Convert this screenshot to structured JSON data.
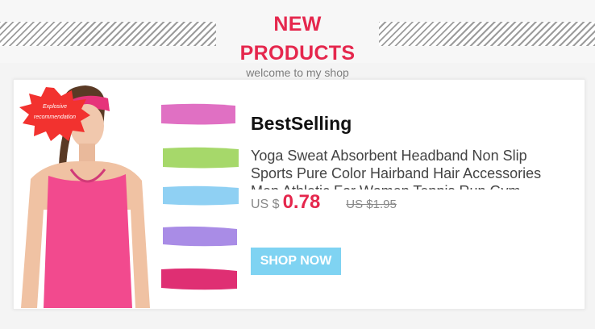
{
  "header": {
    "title": "NEW PRODUCTS",
    "subtitle": "welcome to my shop"
  },
  "product": {
    "badge": [
      "Explosive",
      "recommendation"
    ],
    "brand": "BestSelling",
    "title": "Yoga Sweat Absorbent Headband Non Slip Sports Pure Color Hairband Hair Accessories Men Athletic For Women Tennis Run Gym",
    "currency": "US $",
    "price": "0.78",
    "old_price": "US $1.95",
    "button_label": "SHOP NOW",
    "swatch_colors": [
      "#e070c3",
      "#a6d86a",
      "#8fd0f3",
      "#a98ce6",
      "#df2f73"
    ]
  },
  "colors": {
    "accent": "#e5274d",
    "button": "#7fd3f2",
    "badge": "#f2322f"
  }
}
